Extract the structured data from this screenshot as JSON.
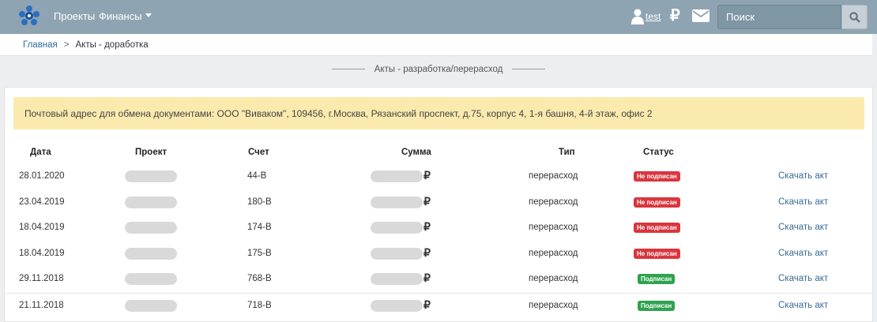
{
  "nav": {
    "projects": "Проекты",
    "finance": "Финансы",
    "user": "test",
    "ruble_symbol": "₽",
    "search_placeholder": "Поиск"
  },
  "breadcrumb": {
    "home": "Главная",
    "separator": ">",
    "current": "Акты - доработка"
  },
  "section_title": "Акты - разработка/перерасход",
  "notice": "Почтовый адрес для обмена документами: ООО \"Виваком\", 109456, г.Москва, Рязанский проспект, д.75, корпус 4, 1-я башня, 4-й этаж, офис 2",
  "table": {
    "headers": {
      "date": "Дата",
      "project": "Проект",
      "invoice": "Счет",
      "amount": "Сумма",
      "type": "Тип",
      "status": "Статус"
    },
    "currency": "₽",
    "rows": [
      {
        "date": "28.01.2020",
        "invoice": "44-В",
        "type": "перерасход",
        "status": "Не подписан",
        "status_kind": "red",
        "action": "Скачать акт"
      },
      {
        "date": "23.04.2019",
        "invoice": "180-В",
        "type": "перерасход",
        "status": "Не подписан",
        "status_kind": "red",
        "action": "Скачать акт"
      },
      {
        "date": "18.04.2019",
        "invoice": "174-В",
        "type": "перерасход",
        "status": "Не подписан",
        "status_kind": "red",
        "action": "Скачать акт"
      },
      {
        "date": "18.04.2019",
        "invoice": "175-В",
        "type": "перерасход",
        "status": "Не подписан",
        "status_kind": "red",
        "action": "Скачать акт"
      },
      {
        "date": "29.11.2018",
        "invoice": "768-В",
        "type": "перерасход",
        "status": "Подписан",
        "status_kind": "green",
        "action": "Скачать акт"
      },
      {
        "date": "21.11.2018",
        "invoice": "718-В",
        "type": "перерасход",
        "status": "Подписан",
        "status_kind": "green",
        "action": "Скачать акт"
      }
    ]
  },
  "colors": {
    "navbar": "#8fa4b2",
    "notice": "#fbeaad",
    "badge_red": "#d9363e",
    "badge_green": "#2fa24d",
    "link": "#3a6a97"
  }
}
